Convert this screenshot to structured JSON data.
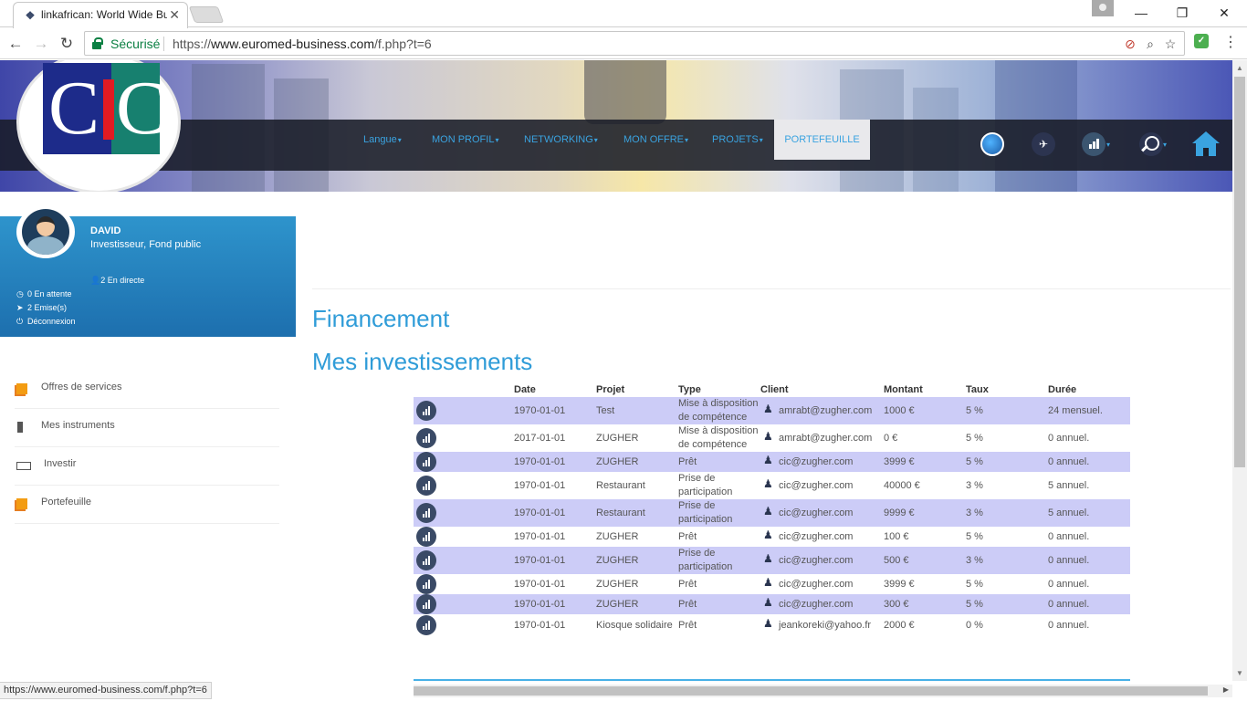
{
  "browser": {
    "tab_title": "linkafrican: World Wide Bu",
    "tab_close": "✕",
    "secure_label": "Sécurisé",
    "url_scheme": "https://",
    "url_host": "www.euromed-business.com",
    "url_path": "/f.php?t=6",
    "status_url": "https://www.euromed-business.com/f.php?t=6"
  },
  "nav": {
    "langue": "Langue",
    "mon_profil": "MON PROFIL",
    "networking": "NETWORKING",
    "mon_offre": "MON OFFRE",
    "projets": "PROJETS",
    "portefeuille": "PORTEFEUILLE"
  },
  "profile": {
    "name": "DAVID",
    "role": "Investisseur, Fond public",
    "direct": "2 En directe",
    "pending": "0 En attente",
    "emitted": "2 Emise(s)",
    "logout": "Déconnexion"
  },
  "sidebar": {
    "items": [
      {
        "label": "Offres de services"
      },
      {
        "label": "Mes instruments"
      },
      {
        "label": "Investir"
      },
      {
        "label": "Portefeuille"
      }
    ]
  },
  "main": {
    "title": "Financement",
    "subtitle": "Mes investissements"
  },
  "table": {
    "headers": [
      "Date",
      "Projet",
      "Type",
      "Client",
      "Montant",
      "Taux",
      "Durée"
    ],
    "rows": [
      {
        "date": "1970-01-01",
        "projet": "Test",
        "type1": "Mise à disposition",
        "type2": "de compétence",
        "client": "amrabt@zugher.com",
        "montant": "1000 €",
        "taux": "5 %",
        "duree": "24 mensuel."
      },
      {
        "date": "2017-01-01",
        "projet": "ZUGHER",
        "type1": "Mise à disposition",
        "type2": "de compétence",
        "client": "amrabt@zugher.com",
        "montant": "0 €",
        "taux": "5 %",
        "duree": "0 annuel."
      },
      {
        "date": "1970-01-01",
        "projet": "ZUGHER",
        "type1": "Prêt",
        "type2": "",
        "client": "cic@zugher.com",
        "montant": "3999 €",
        "taux": "5 %",
        "duree": "0 annuel."
      },
      {
        "date": "1970-01-01",
        "projet": "Restaurant",
        "type1": "Prise de",
        "type2": "participation",
        "client": "cic@zugher.com",
        "montant": "40000 €",
        "taux": "3 %",
        "duree": "5 annuel."
      },
      {
        "date": "1970-01-01",
        "projet": "Restaurant",
        "type1": "Prise de",
        "type2": "participation",
        "client": "cic@zugher.com",
        "montant": "9999 €",
        "taux": "3 %",
        "duree": "5 annuel."
      },
      {
        "date": "1970-01-01",
        "projet": "ZUGHER",
        "type1": "Prêt",
        "type2": "",
        "client": "cic@zugher.com",
        "montant": "100 €",
        "taux": "5 %",
        "duree": "0 annuel."
      },
      {
        "date": "1970-01-01",
        "projet": "ZUGHER",
        "type1": "Prise de",
        "type2": "participation",
        "client": "cic@zugher.com",
        "montant": "500 €",
        "taux": "3 %",
        "duree": "0 annuel."
      },
      {
        "date": "1970-01-01",
        "projet": "ZUGHER",
        "type1": "Prêt",
        "type2": "",
        "client": "cic@zugher.com",
        "montant": "3999 €",
        "taux": "5 %",
        "duree": "0 annuel."
      },
      {
        "date": "1970-01-01",
        "projet": "ZUGHER",
        "type1": "Prêt",
        "type2": "",
        "client": "cic@zugher.com",
        "montant": "300 €",
        "taux": "5 %",
        "duree": "0 annuel."
      },
      {
        "date": "1970-01-01",
        "projet": "Kiosque solidaire",
        "type1": "Prêt",
        "type2": "",
        "client": "jeankoreki@yahoo.fr",
        "montant": "2000 €",
        "taux": "0 %",
        "duree": "0 annuel."
      }
    ]
  },
  "colors": {
    "accent": "#2f9cd8",
    "row_alt": "#ccccf7",
    "card": "#2e94cc",
    "secure": "#0b8043"
  }
}
